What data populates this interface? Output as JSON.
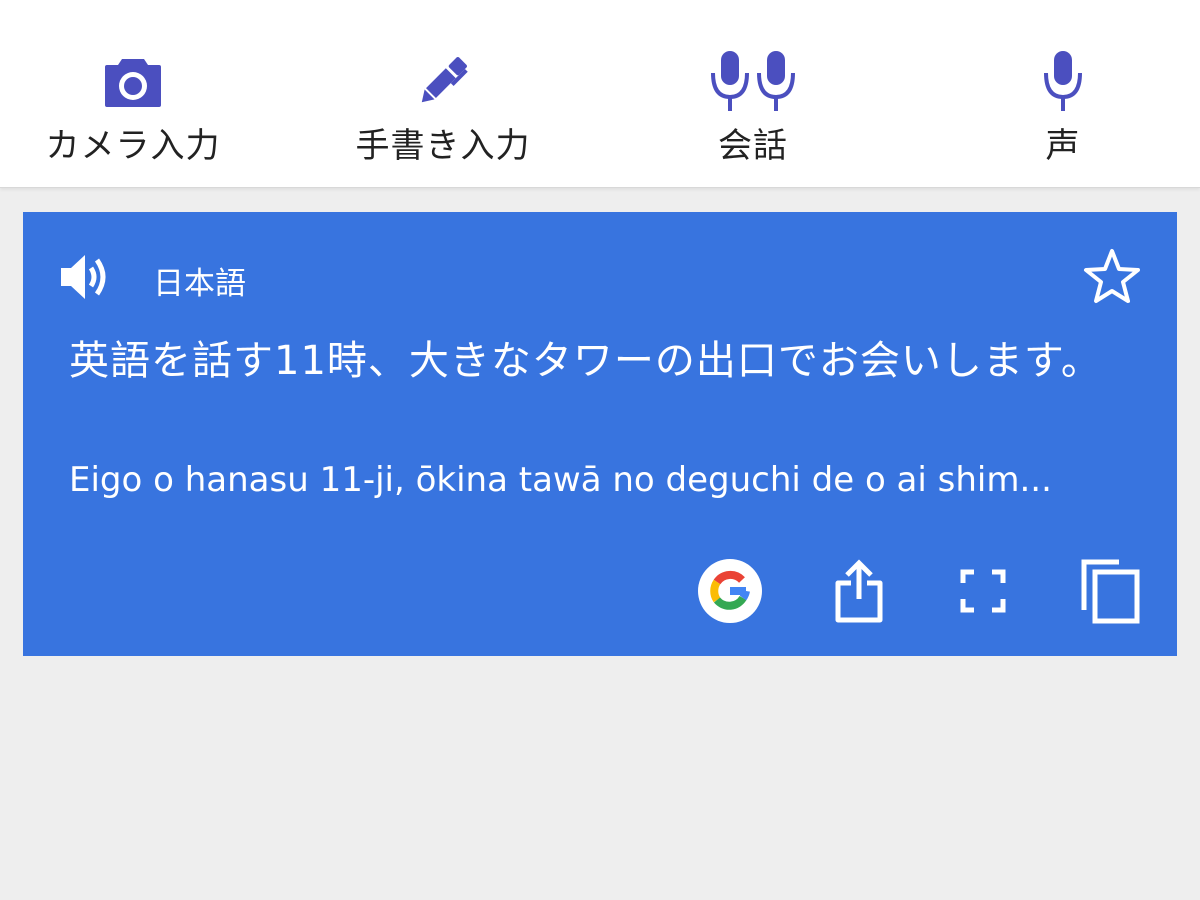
{
  "toolbar": {
    "items": [
      {
        "label": "カメラ入力",
        "icon": "camera-icon"
      },
      {
        "label": "手書き入力",
        "icon": "pen-icon"
      },
      {
        "label": "会話",
        "icon": "conversation-icon"
      },
      {
        "label": "声",
        "icon": "microphone-icon"
      }
    ],
    "accent_color": "#4b4fbf"
  },
  "result_card": {
    "background_color": "#3874df",
    "language": "日本語",
    "translation": "英語を話す11時、大きなタワーの出口でお会いします。",
    "romanization": "Eigo o hanasu 11-ji, ōkina tawā no deguchi de o ai shim...",
    "icons": [
      "speaker-icon",
      "star-icon",
      "google-icon",
      "share-icon",
      "fullscreen-icon",
      "copy-icon"
    ]
  }
}
